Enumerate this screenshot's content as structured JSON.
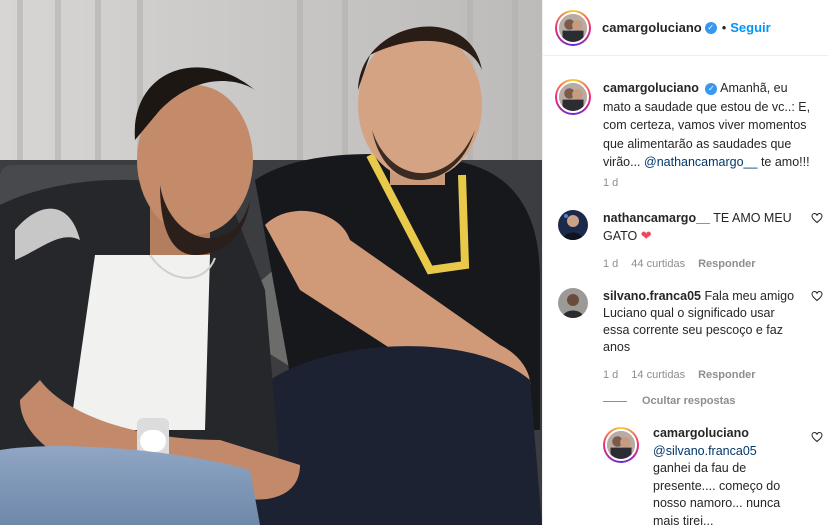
{
  "post": {
    "author": "camargoluciano",
    "follow_label": "Seguir",
    "separator": "•"
  },
  "caption": {
    "author": "camargoluciano",
    "text": "Amanhã, eu mato a saudade que estou de vc..: E, com certeza, vamos viver momentos que alimentarão as saudades que virão...",
    "mention": "@nathancamargo__",
    "text_end": "te amo!!!",
    "time": "1 d"
  },
  "comments": [
    {
      "author": "nathancamargo__",
      "text": "TE AMO MEU GATO",
      "emoji": "❤",
      "time": "1 d",
      "likes": "44 curtidas",
      "reply_label": "Responder"
    },
    {
      "author": "silvano.franca05",
      "text": "Fala meu amigo Luciano qual o significado usar essa corrente seu pescoço e faz anos",
      "time": "1 d",
      "likes": "14 curtidas",
      "reply_label": "Responder"
    }
  ],
  "hide_replies_label": "Ocultar respostas",
  "reply": {
    "author": "camargoluciano",
    "mention": "@silvano.franca05",
    "text": "ganhei da fau de presente.... começo do nosso namoro... nunca mais tirei..."
  },
  "colors": {
    "link_blue": "#0095f6",
    "verified_blue": "#3897f0",
    "mention": "#00376b",
    "secondary_text": "#8e8e8e",
    "heart_red": "#ed4956"
  },
  "icons": {
    "verified": "verified-badge-icon",
    "like": "heart-outline-icon"
  }
}
